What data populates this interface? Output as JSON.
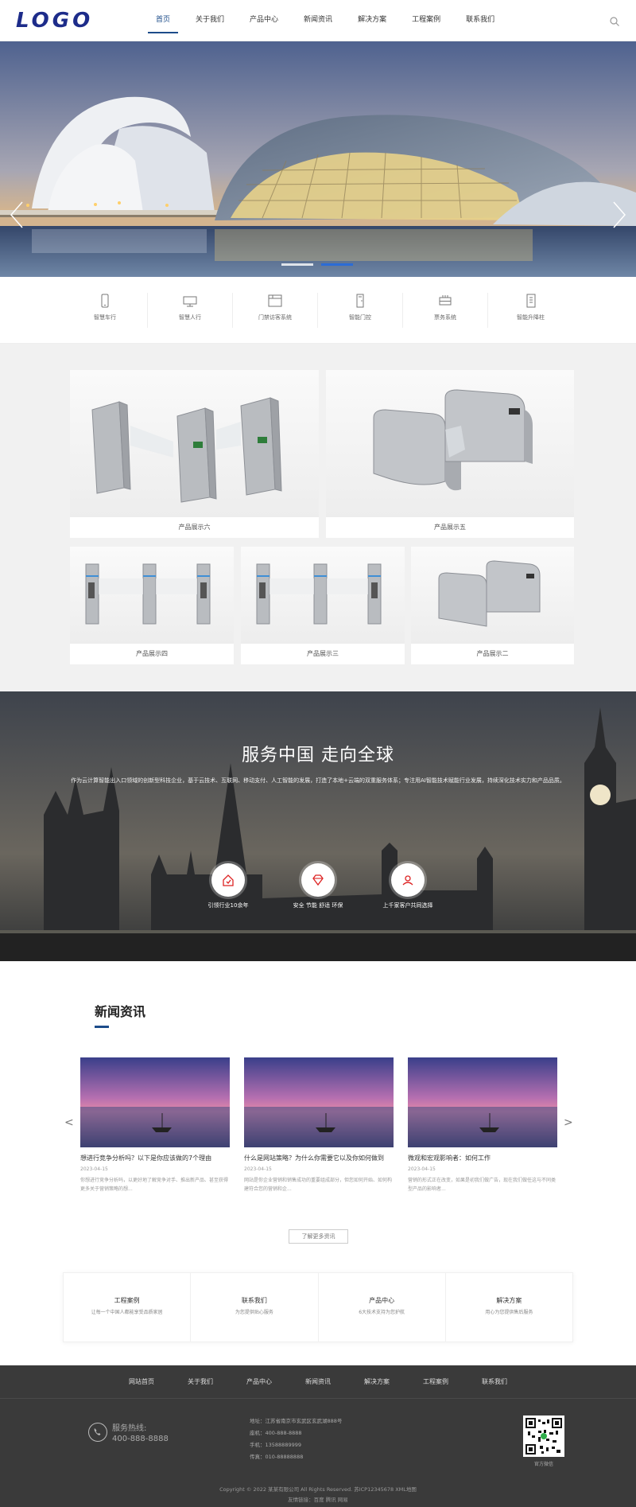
{
  "header": {
    "logo": "LOGO",
    "nav": [
      "首页",
      "关于我们",
      "产品中心",
      "新闻资讯",
      "解决方案",
      "工程案例",
      "联系我们"
    ],
    "active_index": 0
  },
  "banner": {
    "slides": 2,
    "active_slide": 1
  },
  "categories": [
    "智慧车行",
    "智慧人行",
    "门禁访客系统",
    "智能门控",
    "票务系统",
    "智能升降柱"
  ],
  "products": [
    "产品展示六",
    "产品展示五",
    "产品展示四",
    "产品展示三",
    "产品展示二"
  ],
  "service": {
    "title": "服务中国 走向全球",
    "desc": "作为云计算智能出入口领域的创新型科技企业，基于云技术、互联网、移动支付、人工智能的发展，打造了本地+云端的双重服务体系；专注用AI智能技术赋能行业发展，持续深化技术实力和产品品质。",
    "features": [
      "引领行业10余年",
      "安全 节能 舒适 环保",
      "上千家客户共同选择"
    ]
  },
  "news": {
    "title": "新闻资讯",
    "items": [
      {
        "title": "想进行竞争分析吗？以下是你应该做的7个理由",
        "date": "2023-04-15",
        "summary": "你想进行竞争分析吗，以更好地了解竞争对手、推出新产品、甚至获得更多关于营销策略的想..."
      },
      {
        "title": "什么是网站策略？为什么你需要它以及你如何做到",
        "date": "2023-04-15",
        "summary": "网站是你企业营销和销售成功的重要组成部分，但您如何开始、如何构建符合您的营销和企..."
      },
      {
        "title": "微观和宏观影响者：如何工作",
        "date": "2023-04-15",
        "summary": "营销的形式正在改变，如果是初我们做广告，现在我们做任这与不同类型产品的影响者..."
      }
    ],
    "more": "了解更多资讯"
  },
  "quick_links": [
    {
      "title": "工程案例",
      "sub": "让每一个中国人都能享受品质家居"
    },
    {
      "title": "联系我们",
      "sub": "为您提供贴心服务"
    },
    {
      "title": "产品中心",
      "sub": "6大技术支持为您护航"
    },
    {
      "title": "解决方案",
      "sub": "用心为您提供售后服务"
    }
  ],
  "footer": {
    "nav": [
      "网站首页",
      "关于我们",
      "产品中心",
      "新闻资讯",
      "解决方案",
      "工程案例",
      "联系我们"
    ],
    "hotline_label": "服务热线:",
    "hotline": "400-888-8888",
    "info": [
      "地址：江苏省南京市玄武区玄武湖888号",
      "座机：400-888-8888",
      "手机：13588889999",
      "传真：010-88888888"
    ],
    "qr_label": "官方微信",
    "copyright": "Copyright © 2022 某某有限公司 All Rights Reserved. 苏ICP12345678 XML地图",
    "links": "友情链接：百度 腾讯 网易"
  }
}
